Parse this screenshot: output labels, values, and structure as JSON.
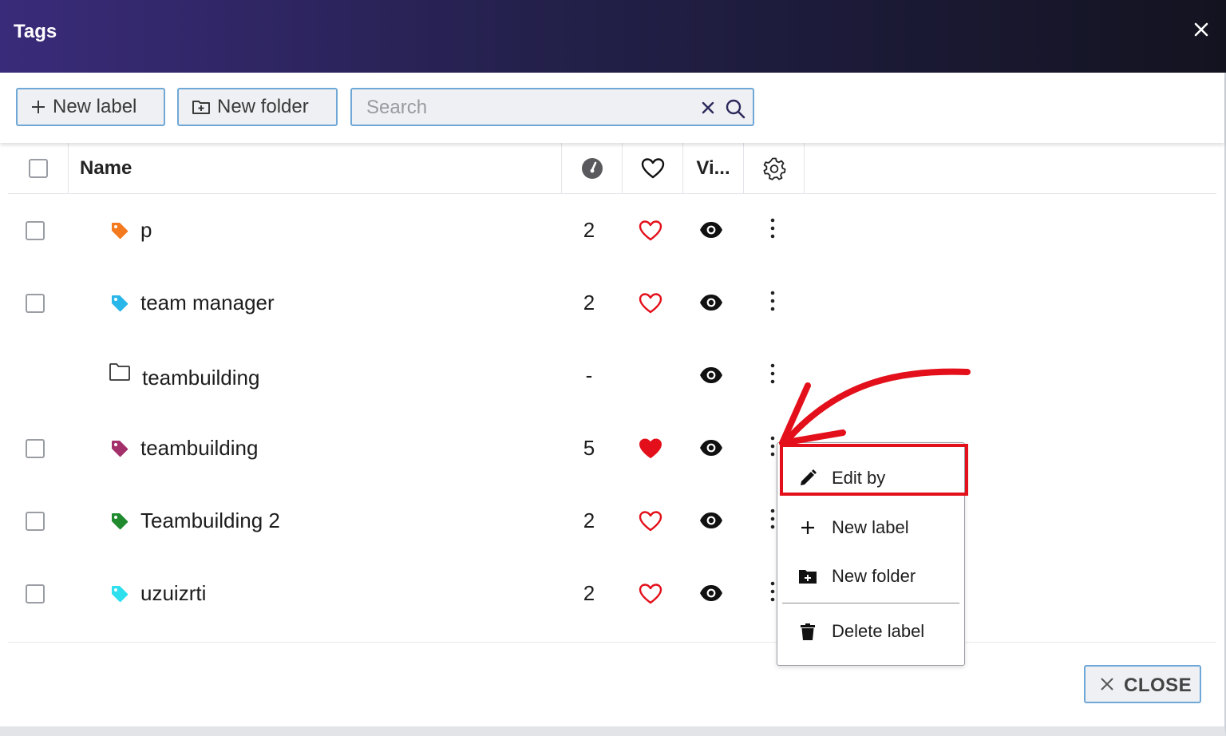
{
  "dialog": {
    "title": "Tags",
    "close_icon": "close-icon"
  },
  "toolbar": {
    "new_label": "New label",
    "new_folder": "New folder",
    "search_placeholder": "Search",
    "search_value": ""
  },
  "table": {
    "columns": {
      "name": "Name",
      "count_icon": "gauge-icon",
      "favorite_icon": "heart-icon",
      "visible": "Vi...",
      "settings_icon": "gear-icon"
    },
    "rows": [
      {
        "name": "p",
        "type": "label",
        "color": "#f47a20",
        "count": "2",
        "favorite": false,
        "has_checkbox": true
      },
      {
        "name": "team manager",
        "type": "label",
        "color": "#29b6e8",
        "count": "2",
        "favorite": false,
        "has_checkbox": true
      },
      {
        "name": "teambuilding",
        "type": "folder",
        "color": "#333333",
        "count": "-",
        "favorite": null,
        "has_checkbox": false
      },
      {
        "name": "teambuilding",
        "type": "label",
        "color": "#a3306b",
        "count": "5",
        "favorite": true,
        "has_checkbox": true
      },
      {
        "name": "Teambuilding 2",
        "type": "label",
        "color": "#1f8a2e",
        "count": "2",
        "favorite": false,
        "has_checkbox": true
      },
      {
        "name": "uzuizrti",
        "type": "label",
        "color": "#2ee0ee",
        "count": "2",
        "favorite": false,
        "has_checkbox": true
      }
    ]
  },
  "context_menu": {
    "items": [
      {
        "label": "Edit by",
        "icon": "pencil-icon"
      },
      {
        "label": "New label",
        "icon": "plus-icon"
      },
      {
        "label": "New folder",
        "icon": "folder-plus-icon"
      },
      {
        "label": "Delete label",
        "icon": "trash-icon"
      }
    ]
  },
  "footer": {
    "close_label": "CLOSE"
  },
  "colors": {
    "accent_border": "#6fa8d6",
    "heart_red": "#e3101b",
    "highlight_red": "#e3101b"
  }
}
